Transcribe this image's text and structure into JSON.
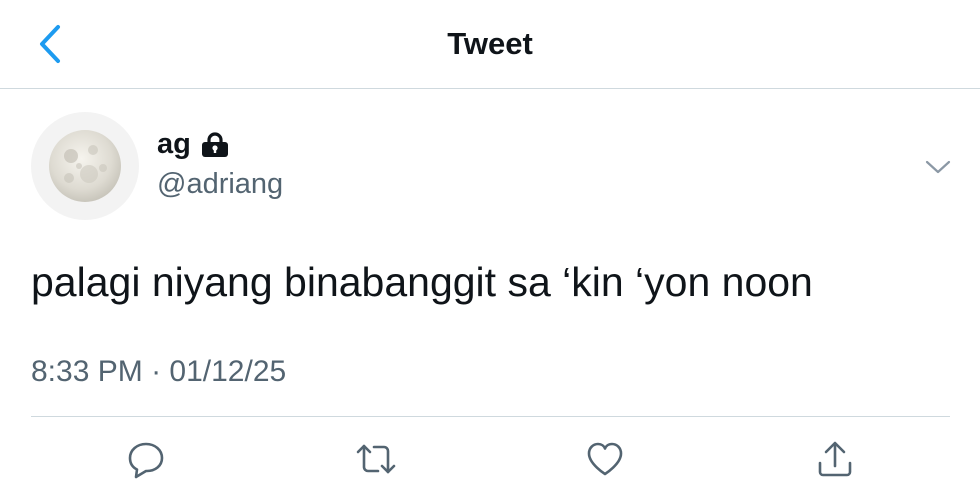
{
  "header": {
    "title": "Tweet",
    "back_icon": "chevron-left-icon",
    "accent_color": "#1d9bf0"
  },
  "tweet": {
    "author": {
      "display_name": "ag",
      "handle": "@adriang",
      "protected_icon": "lock-icon",
      "avatar": "moon-avatar"
    },
    "text": "palagi niyang binabanggit sa ‘kin ‘yon noon",
    "time": "8:33 PM",
    "separator": "·",
    "date": "01/12/25",
    "more_icon": "chevron-down-icon"
  },
  "actions": [
    {
      "name": "reply",
      "icon": "reply-icon"
    },
    {
      "name": "retweet",
      "icon": "retweet-icon"
    },
    {
      "name": "like",
      "icon": "heart-icon"
    },
    {
      "name": "share",
      "icon": "share-icon"
    }
  ]
}
